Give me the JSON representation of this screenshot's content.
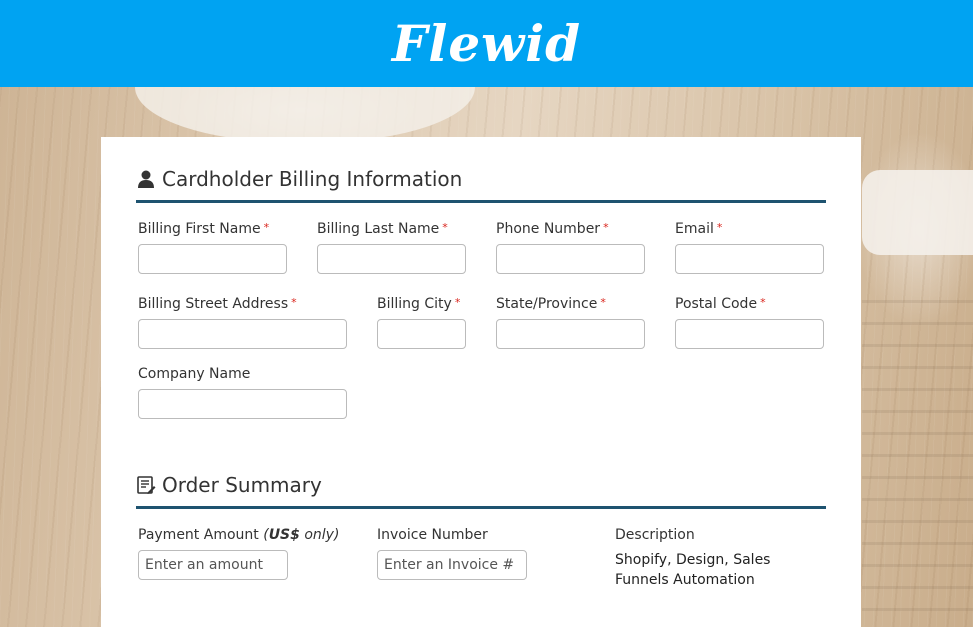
{
  "header": {
    "logo": "Flewid",
    "bg": "#00a3f2"
  },
  "billing": {
    "title": "Cardholder Billing Information",
    "icon": "user-icon",
    "fields": {
      "first_name": "Billing First Name",
      "last_name": "Billing Last Name",
      "phone": "Phone Number",
      "email": "Email",
      "street": "Billing Street Address",
      "city": "Billing City",
      "state": "State/Province",
      "postal": "Postal Code",
      "company": "Company Name"
    },
    "required_mark": "*"
  },
  "order": {
    "title": "Order Summary",
    "icon": "invoice-icon",
    "payment_label": "Payment Amount",
    "payment_note": "(US$ only)",
    "payment_note_bold": "US$",
    "payment_placeholder": "Enter an amount",
    "invoice_label": "Invoice Number",
    "invoice_placeholder": "Enter an Invoice #",
    "description_label": "Description",
    "description_text": "Shopify, Design, Sales Funnels Automation"
  },
  "colors": {
    "accent_rule": "#1e5370",
    "required": "#d9241c"
  }
}
